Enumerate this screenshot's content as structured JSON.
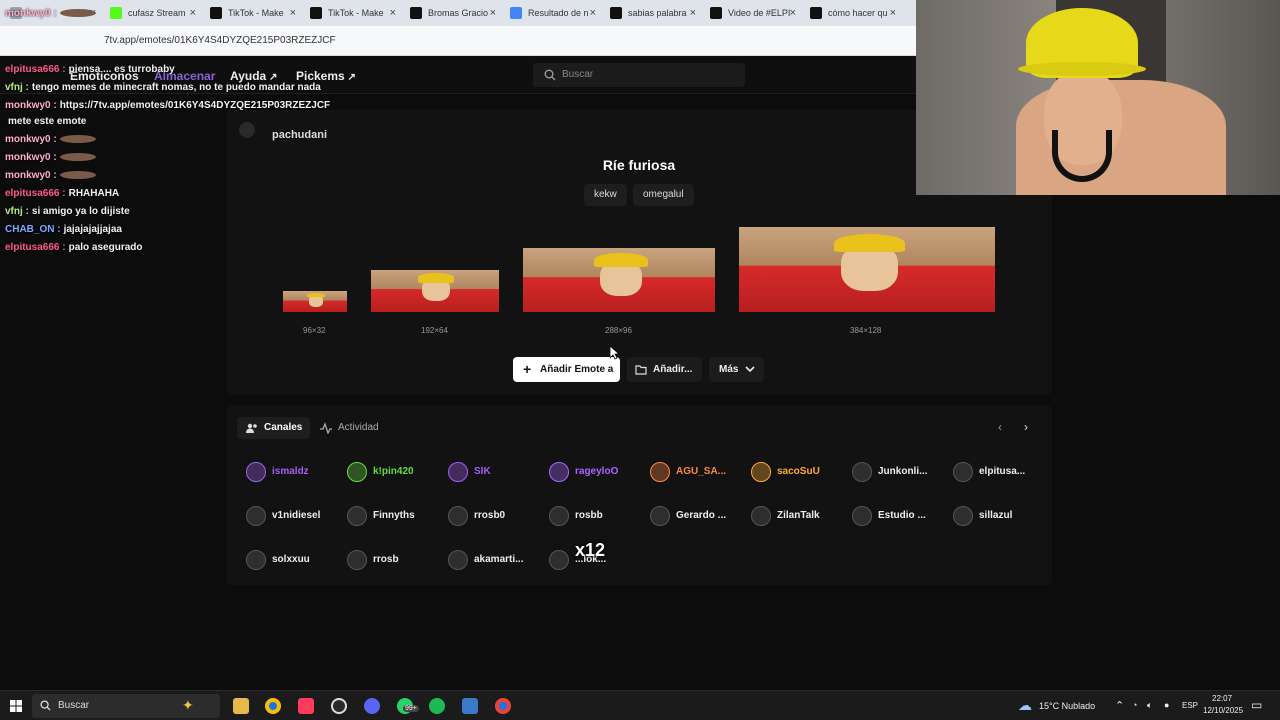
{
  "browser": {
    "tabs": [
      {
        "label": "",
        "color": "#9aa3b0"
      },
      {
        "label": "cufasz Stream",
        "color": "#53fc18"
      },
      {
        "label": "TikTok - Make",
        "color": "#111111"
      },
      {
        "label": "TikTok - Make",
        "color": "#111111"
      },
      {
        "label": "Bromas Gracio",
        "color": "#111111"
      },
      {
        "label": "Resultado de n",
        "color": "#4285f4"
      },
      {
        "label": "sabias palabra",
        "color": "#111111"
      },
      {
        "label": "Video de #ELPI",
        "color": "#111111"
      },
      {
        "label": "cómo hacer qu",
        "color": "#111111"
      }
    ],
    "url": "7tv.app/emotes/01K6Y4S4DYZQE215P03RZEZJCF"
  },
  "nav": {
    "emotes": "Emoticonos",
    "store": "Almacenar",
    "help": "Ayuda",
    "pickems": "Pickems",
    "search_placeholder": "Buscar"
  },
  "emote": {
    "owner": "pachudani",
    "name": "Ríe furiosa",
    "tags": [
      "kekw",
      "omegalul"
    ],
    "sizes": [
      "96×32",
      "192×64",
      "288×96",
      "384×128"
    ],
    "add_button": "Añadir Emote a",
    "add_to_button": "Añadir...",
    "more_button": "Más"
  },
  "channels": {
    "tab_channels": "Canales",
    "tab_activity": "Actividad",
    "list": [
      {
        "name": "ismaldz",
        "color": "#a55ef5"
      },
      {
        "name": "k!pin420",
        "color": "#66dd44"
      },
      {
        "name": "SIK",
        "color": "#a55ef5"
      },
      {
        "name": "rageyloO",
        "color": "#aa66ff"
      },
      {
        "name": "AGU_SA...",
        "color": "#ff8844"
      },
      {
        "name": "sacoSuU",
        "color": "#ffaa33"
      },
      {
        "name": "Junkonli...",
        "color": "#eeeeee"
      },
      {
        "name": "elpitusa...",
        "color": "#eeeeee"
      },
      {
        "name": "v1nidiesel",
        "color": "#eeeeee"
      },
      {
        "name": "Finnyths",
        "color": "#eeeeee"
      },
      {
        "name": "rrosb0",
        "color": "#eeeeee"
      },
      {
        "name": "rosbb",
        "color": "#eeeeee"
      },
      {
        "name": "Gerardo ...",
        "color": "#eeeeee"
      },
      {
        "name": "ZilanTalk",
        "color": "#eeeeee"
      },
      {
        "name": "Estudio ...",
        "color": "#eeeeee"
      },
      {
        "name": "sillazul",
        "color": "#eeeeee"
      },
      {
        "name": "solxxuu",
        "color": "#eeeeee"
      },
      {
        "name": "rrosb",
        "color": "#eeeeee"
      },
      {
        "name": "akamarti...",
        "color": "#eeeeee"
      },
      {
        "name": "...lok...",
        "color": "#eeeeee"
      }
    ]
  },
  "chat": [
    {
      "user": "monkwy0 :",
      "color": "#ffb0c8",
      "text": ""
    },
    {
      "user": "elpitusa666 :",
      "color": "#ff5c8a",
      "text": "piensa ... es turrobaby"
    },
    {
      "user": "vfnj :",
      "color": "#b8e986",
      "text": "tengo memes de minecraft nomas, no te puedo mandar nada"
    },
    {
      "user": "monkwy0 :",
      "color": "#ffb0c8",
      "text": "https://7tv.app/emotes/01K6Y4S4DYZQE215P03RZEZJCF"
    },
    {
      "user": "",
      "color": "#ffffff",
      "text": "mete este emote"
    },
    {
      "user": "monkwy0 :",
      "color": "#ffb0c8",
      "text": ""
    },
    {
      "user": "monkwy0 :",
      "color": "#ffb0c8",
      "text": ""
    },
    {
      "user": "monkwy0 :",
      "color": "#ffb0c8",
      "text": ""
    },
    {
      "user": "elpitusa666 :",
      "color": "#ff5c8a",
      "text": "RHAHAHA"
    },
    {
      "user": "vfnj :",
      "color": "#b8e986",
      "text": "si amigo ya lo dijiste"
    },
    {
      "user": "CHAB_ON :",
      "color": "#7fa8ff",
      "text": "jajajajajjajaa"
    },
    {
      "user": "elpitusa666 :",
      "color": "#ff5c8a",
      "text": "palo asegurado"
    }
  ],
  "overlay_badge": "x12",
  "taskbar": {
    "search_placeholder": "Buscar",
    "badge": "99+",
    "weather": "15°C Nublado",
    "lang": "ESP",
    "time": "22:07",
    "date": "12/10/2025"
  }
}
